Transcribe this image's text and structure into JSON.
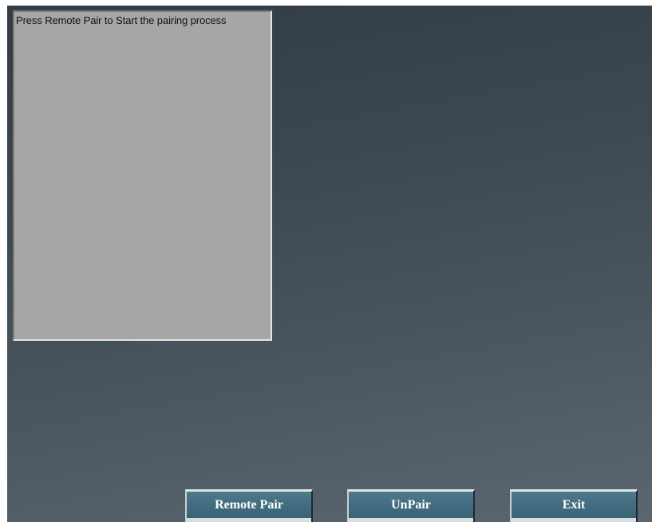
{
  "status": {
    "message": "Press Remote Pair to Start the pairing process"
  },
  "buttons": {
    "remote_pair": "Remote Pair",
    "unpair": "UnPair",
    "exit": "Exit"
  },
  "colors": {
    "background_top": "#333c44",
    "background_bottom": "#5a6771",
    "panel": "#a6a6a6",
    "button": "#446f83"
  }
}
